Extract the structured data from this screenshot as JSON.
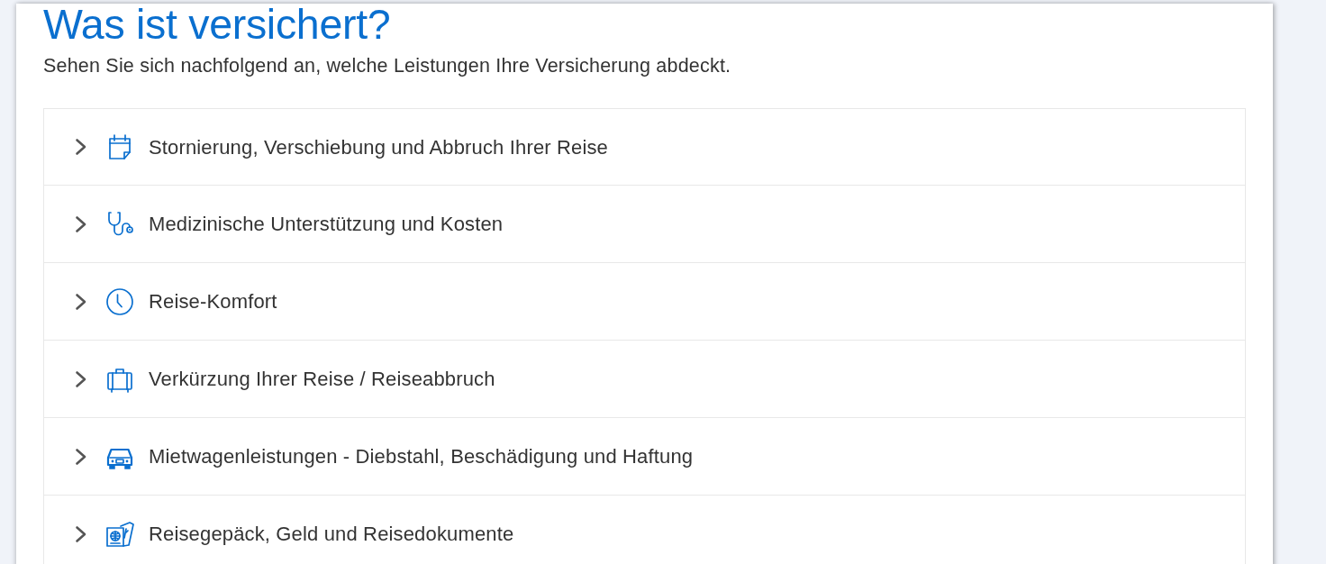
{
  "header": {
    "title": "Was ist versichert?",
    "subtitle": "Sehen Sie sich nachfolgend an, welche Leistungen Ihre Versicherung abdeckt."
  },
  "coverage_items": [
    {
      "label": "Stornierung, Verschiebung und Abbruch Ihrer Reise",
      "expanded": false
    },
    {
      "label": "Medizinische Unterstützung und Kosten",
      "expanded": false
    },
    {
      "label": "Reise-Komfort",
      "expanded": false
    },
    {
      "label": "Verkürzung Ihrer Reise / Reiseabbruch",
      "expanded": false
    },
    {
      "label": "Mietwagenleistungen - Diebstahl, Beschädigung und Haftung",
      "expanded": false
    },
    {
      "label": "Reisegepäck, Geld und Reisedokumente",
      "expanded": false
    }
  ]
}
